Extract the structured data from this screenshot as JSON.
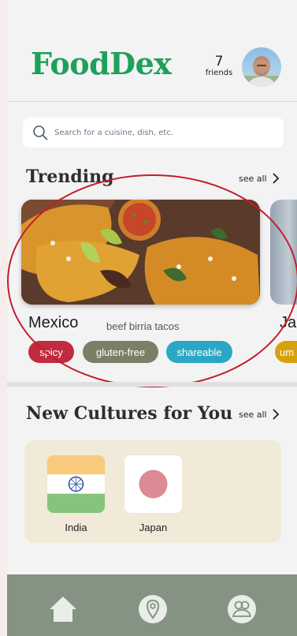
{
  "header": {
    "brand": "FoodDex",
    "friends_count": "7",
    "friends_label": "friends",
    "brand_color": "#1ea05b"
  },
  "search": {
    "placeholder": "Search for a cuisine, dish, etc.",
    "icon": "search-icon"
  },
  "trending": {
    "title": "Trending",
    "see_all": "see all",
    "card": {
      "country": "Mexico",
      "dish": "beef birria tacos",
      "tags": [
        {
          "label": "spicy",
          "color": "#c02b40"
        },
        {
          "label": "gluten-free",
          "color": "#7a7f66"
        },
        {
          "label": "shareable",
          "color": "#2aa7c4"
        }
      ]
    },
    "next_card": {
      "country": "Jap",
      "tag": "um"
    }
  },
  "new_cultures": {
    "title": "New Cultures for You",
    "see_all": "see all",
    "items": [
      {
        "name": "India"
      },
      {
        "name": "Japan"
      }
    ]
  },
  "nav": {
    "items": [
      {
        "icon": "home-icon"
      },
      {
        "icon": "map-pin-icon"
      },
      {
        "icon": "friends-icon"
      }
    ],
    "color": "#849382"
  },
  "annotation_color": "#c41d2a"
}
